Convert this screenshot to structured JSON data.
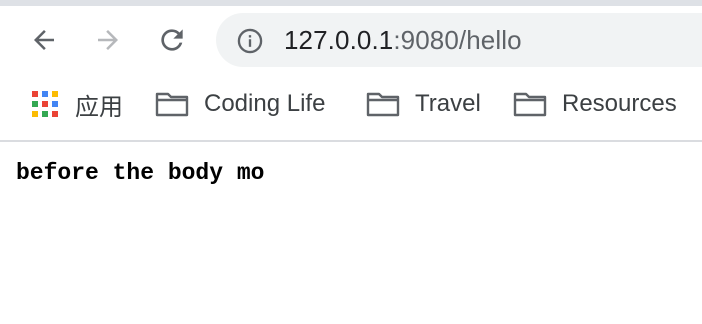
{
  "address_bar": {
    "host": "127.0.0.1",
    "rest": ":9080/hello"
  },
  "bookmarks": {
    "apps_label": "应用",
    "items": [
      {
        "label": "Coding Life"
      },
      {
        "label": "Travel"
      },
      {
        "label": "Resources"
      }
    ]
  },
  "page": {
    "body_text": "before the body mo"
  },
  "colors": {
    "icon_gray": "#5f6368",
    "disabled_gray": "#b6b8bb",
    "omnibox_bg": "#f1f3f4"
  },
  "icons": [
    "back-arrow-icon",
    "forward-arrow-icon",
    "reload-icon",
    "info-icon",
    "apps-grid-icon",
    "folder-icon"
  ]
}
